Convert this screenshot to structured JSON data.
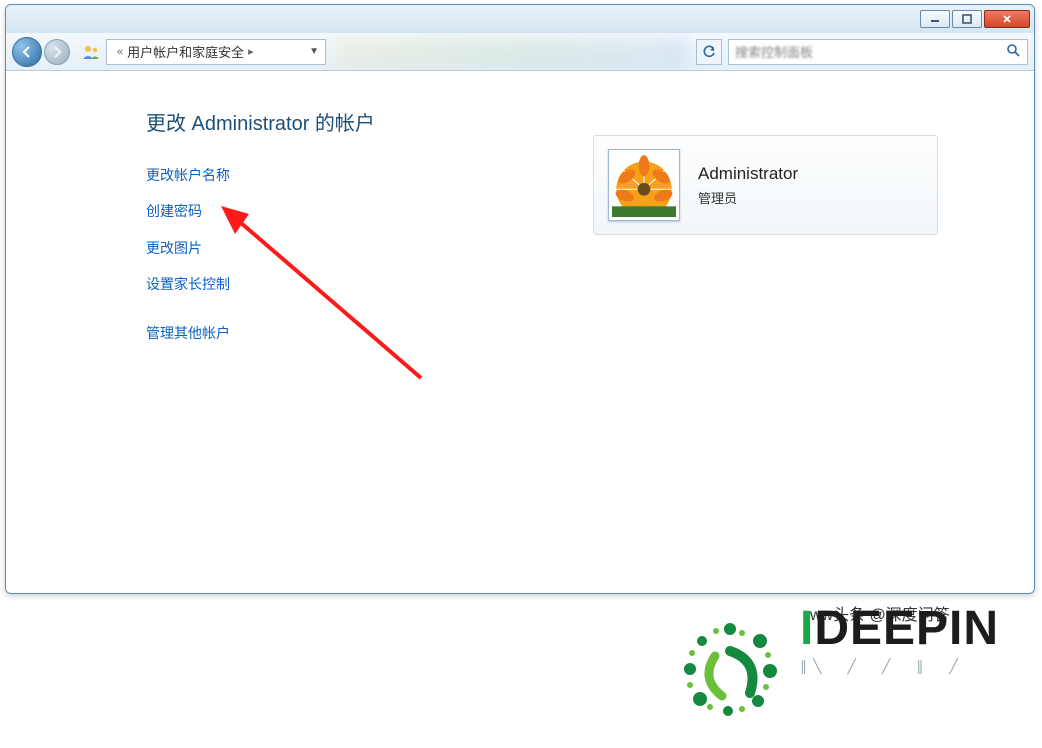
{
  "window": {
    "controls": {
      "min": "minimize",
      "max": "maximize",
      "close": "close"
    }
  },
  "nav": {
    "breadcrumb_prefix": "«",
    "breadcrumb": "用户帐户和家庭安全",
    "breadcrumb_suffix": "▸",
    "search_placeholder": "搜索控制面板"
  },
  "page": {
    "title": "更改 Administrator 的帐户"
  },
  "links": {
    "l1": "更改帐户名称",
    "l2": "创建密码",
    "l3": "更改图片",
    "l4": "设置家长控制",
    "l5": "管理其他帐户"
  },
  "account": {
    "name": "Administrator",
    "role": "管理员"
  },
  "watermark": {
    "brand_prefix": "I",
    "brand_rest": "DEEPIN",
    "credit": "ww头条 @深度问答"
  }
}
